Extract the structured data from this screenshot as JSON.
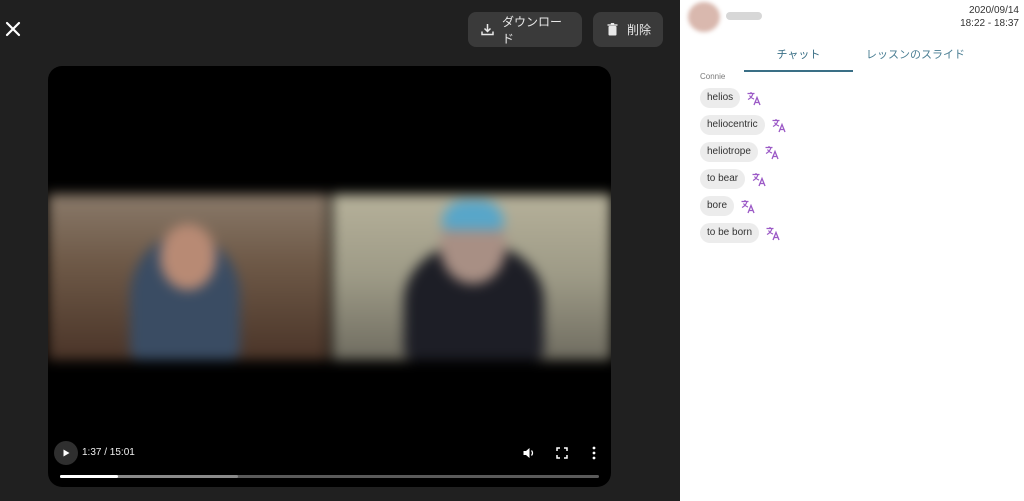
{
  "toolbar": {
    "download_label": "ダウンロード",
    "delete_label": "削除"
  },
  "player": {
    "current_time": "1:37",
    "duration": "15:01",
    "time_display": "1:37 / 15:01",
    "played_fraction": 0.108,
    "buffered_fraction": 0.33
  },
  "session": {
    "date": "2020/09/14",
    "time_range": "18:22 - 18:37"
  },
  "tabs": [
    {
      "label": "チャット",
      "active": true
    },
    {
      "label": "レッスンのスライド",
      "active": false
    }
  ],
  "chat": {
    "sender": "Connie",
    "messages": [
      {
        "text": "helios"
      },
      {
        "text": "heliocentric"
      },
      {
        "text": "heliotrope"
      },
      {
        "text": "to bear"
      },
      {
        "text": "bore"
      },
      {
        "text": "to be born"
      }
    ]
  },
  "colors": {
    "accent": "#3a6f86",
    "translate_icon": "#9b59c6",
    "panel_bg": "#202020"
  },
  "icons": {
    "close": "close-icon",
    "download": "download-icon",
    "delete": "trash-icon",
    "play": "play-icon",
    "volume": "volume-icon",
    "fullscreen": "fullscreen-icon",
    "more": "more-vertical-icon",
    "translate": "translate-icon"
  }
}
